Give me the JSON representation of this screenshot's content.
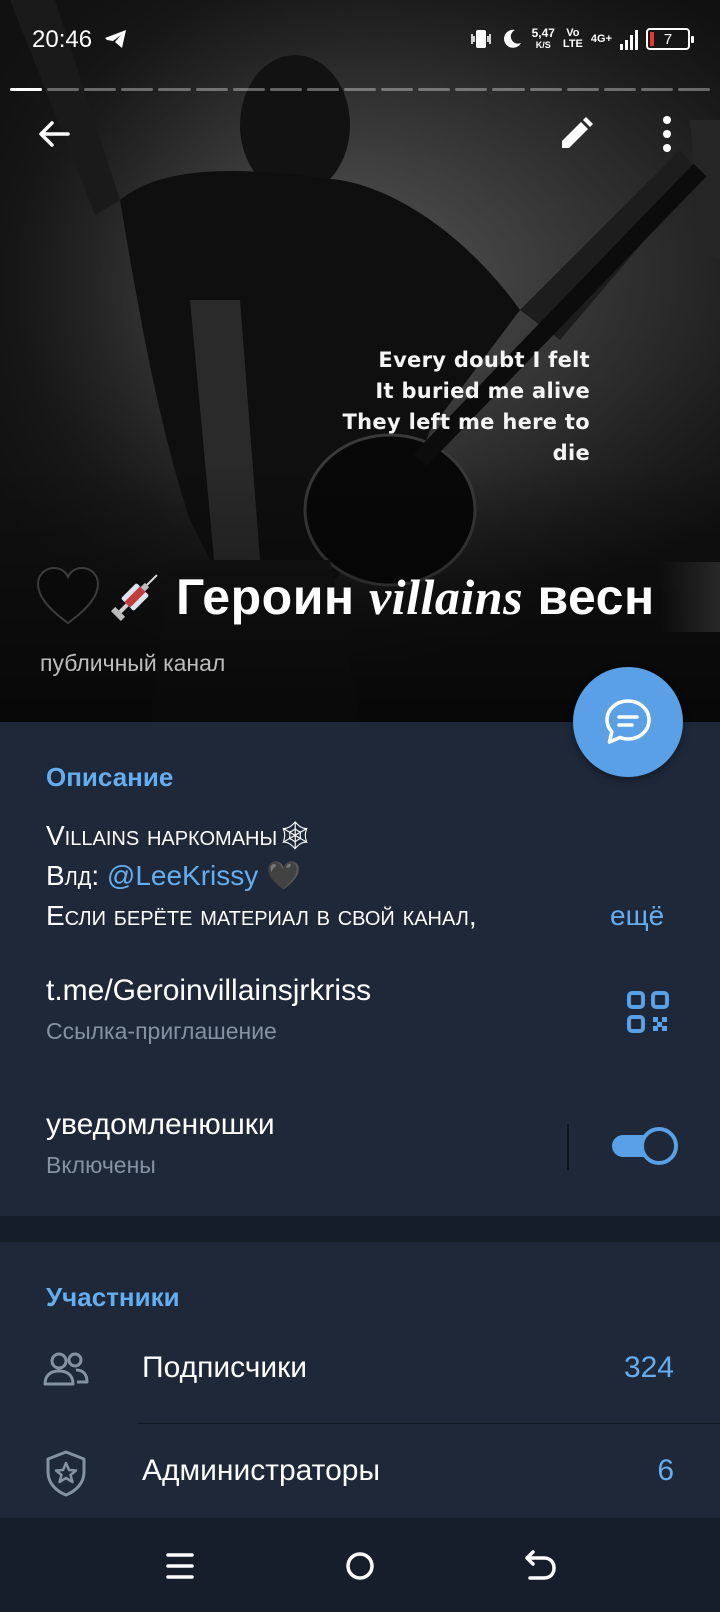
{
  "status_bar": {
    "time": "20:46",
    "net_speed": "5,47",
    "net_unit": "K/S",
    "volte_top": "Vo",
    "volte_bottom": "LTE",
    "network": "4G+",
    "battery": "7",
    "icons": [
      "telegram-icon",
      "vibrate-icon",
      "moon-icon",
      "signal-icon",
      "battery-icon"
    ]
  },
  "story": {
    "segments": 19,
    "active_index": 0
  },
  "header": {
    "back_icon": "arrow-left-icon",
    "edit_icon": "pencil-icon",
    "more_icon": "dots-vertical-icon"
  },
  "hero": {
    "lyrics": [
      "Every doubt I felt",
      "It buried me alive",
      "They left me here to die"
    ]
  },
  "channel": {
    "title_prefix": "Героин ",
    "title_italic": "villains",
    "title_suffix": " весн",
    "type": "публичный канал",
    "emojis": [
      "black-heart-emoji",
      "syringe-emoji"
    ]
  },
  "fab": {
    "icon": "chat-bubble-icon"
  },
  "info": {
    "description_header": "Описание",
    "description_line1": "Villains наркоманы🕸",
    "description_line2_prefix": "Влд: ",
    "description_line2_link": "@LeeKrissy",
    "description_line2_suffix": " 🖤",
    "description_line3": "Если берёте материал в свой канал,",
    "more": "ещё",
    "link_value": "t.me/Geroinvillainsjrkriss",
    "link_label": "Ссылка-приглашение",
    "notifications_title": "уведомленюшки",
    "notifications_status": "Включены",
    "notifications_on": true
  },
  "members": {
    "header": "Участники",
    "rows": [
      {
        "label": "Подписчики",
        "count": "324",
        "icon": "people-icon"
      },
      {
        "label": "Администраторы",
        "count": "6",
        "icon": "shield-star-icon"
      }
    ]
  },
  "navbar": {
    "icons": [
      "menu-icon",
      "home-circle-icon",
      "back-arrow-icon"
    ]
  },
  "colors": {
    "accent": "#64aef0",
    "fab": "#5aa0e6",
    "panel": "#1e2839",
    "subtext": "#8592a2"
  }
}
